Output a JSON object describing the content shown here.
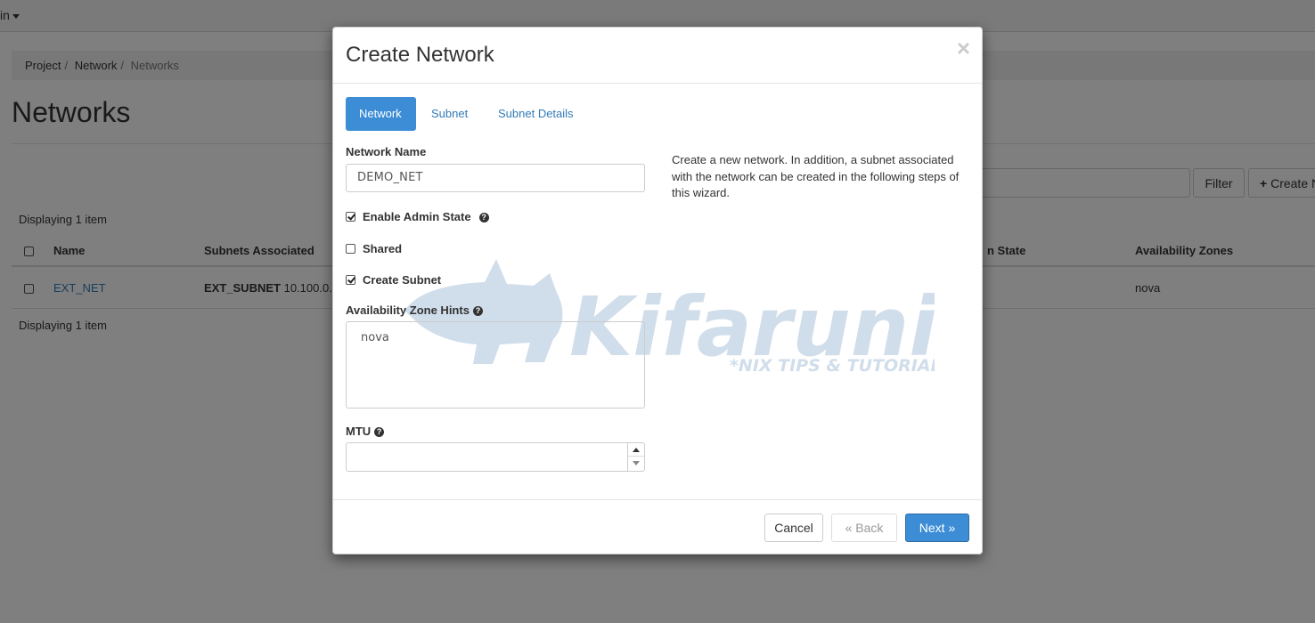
{
  "topbar": {
    "user_label": "in"
  },
  "breadcrumb": {
    "items": [
      "Project",
      "Network",
      "Networks"
    ]
  },
  "page": {
    "title": "Networks"
  },
  "toolbar": {
    "filter_label": "Filter",
    "create_label": "Create N"
  },
  "table": {
    "count_text": "Displaying 1 item",
    "headers": [
      "Name",
      "Subnets Associated",
      "n State",
      "Availability Zones"
    ],
    "rows": [
      {
        "name": "EXT_NET",
        "subnet_name": "EXT_SUBNET",
        "subnet_cidr": "10.100.0.",
        "zone": "nova"
      }
    ]
  },
  "modal": {
    "title": "Create Network",
    "close_glyph": "×",
    "tabs": [
      {
        "label": "Network",
        "active": true
      },
      {
        "label": "Subnet",
        "active": false
      },
      {
        "label": "Subnet Details",
        "active": false
      }
    ],
    "network_name": {
      "label": "Network Name",
      "value": "DEMO_NET"
    },
    "checkboxes": [
      {
        "label": "Enable Admin State",
        "checked": true,
        "help": true
      },
      {
        "label": "Shared",
        "checked": false,
        "help": false
      },
      {
        "label": "Create Subnet",
        "checked": true,
        "help": false
      }
    ],
    "az_hints": {
      "label": "Availability Zone Hints",
      "options": [
        "nova"
      ]
    },
    "mtu": {
      "label": "MTU",
      "value": ""
    },
    "help_text": "Create a new network. In addition, a subnet associated with the network can be created in the following steps of this wizard.",
    "watermark": {
      "brand": "Kifarunix",
      "tagline": "*NIX TIPS & TUTORIALS"
    },
    "footer": {
      "cancel_label": "Cancel",
      "back_label": "«  Back",
      "next_label": "Next  »"
    }
  },
  "colors": {
    "primary": "#3c8dd6",
    "link": "#337ab7",
    "watermark": "#2f6aa3"
  }
}
